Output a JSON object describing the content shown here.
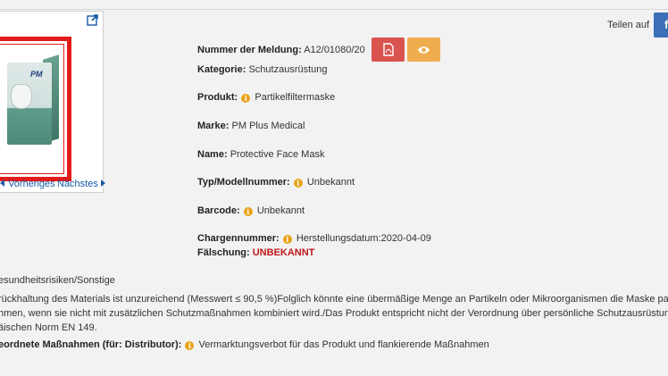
{
  "navigation": {
    "previous": "Vorheriges",
    "next": "Nächstes"
  },
  "share": {
    "label": "Teilen auf",
    "facebook_letter": "f"
  },
  "image": {
    "brand_mark": "PM"
  },
  "report": {
    "number_label": "Nummer der Meldung:",
    "number_value": "A12/01080/20",
    "category_label": "Kategorie:",
    "category_value": "Schutzausrüstung",
    "product_label": "Produkt:",
    "product_value": "Partikelfiltermaske",
    "brand_label": "Marke:",
    "brand_value": "PM Plus Medical",
    "name_label": "Name:",
    "name_value": "Protective Face Mask",
    "model_label": "Typ/Modellnummer:",
    "model_value": "Unbekannt",
    "barcode_label": "Barcode:",
    "barcode_value": "Unbekannt",
    "batch_label": "Chargennummer:",
    "batch_value": "Herstellungsdatum:2020-04-09",
    "fake_label": "Fälschung:",
    "fake_value": "UNBEKANNT"
  },
  "risk": {
    "type_text": "esundheitsrisiken/Sonstige",
    "line1": "rückhaltung des Materials ist unzureichend (Messwert ≤ 90,5 %)Folglich könnte eine übermäßige Menge an Partikeln oder Mikroorganismen die Maske pa",
    "line2": "hmen, wenn sie nicht mit zusätzlichen Schutzmaßnahmen kombiniert wird./Das Produkt entspricht nicht der Verordnung über persönliche Schutzausrüstung",
    "line3": "äischen Norm EN 149."
  },
  "measures": {
    "label": "eordnete Maßnahmen (für: Distributor):",
    "value": "Vermarktungsverbot für das Produkt und flankierende Maßnahmen"
  },
  "colors": {
    "pdf_button": "#d9534f",
    "eye_button": "#f0ad4e",
    "fake_value": "#c0171b",
    "info_icon": "#e8a317",
    "link": "#1a5aa6"
  }
}
